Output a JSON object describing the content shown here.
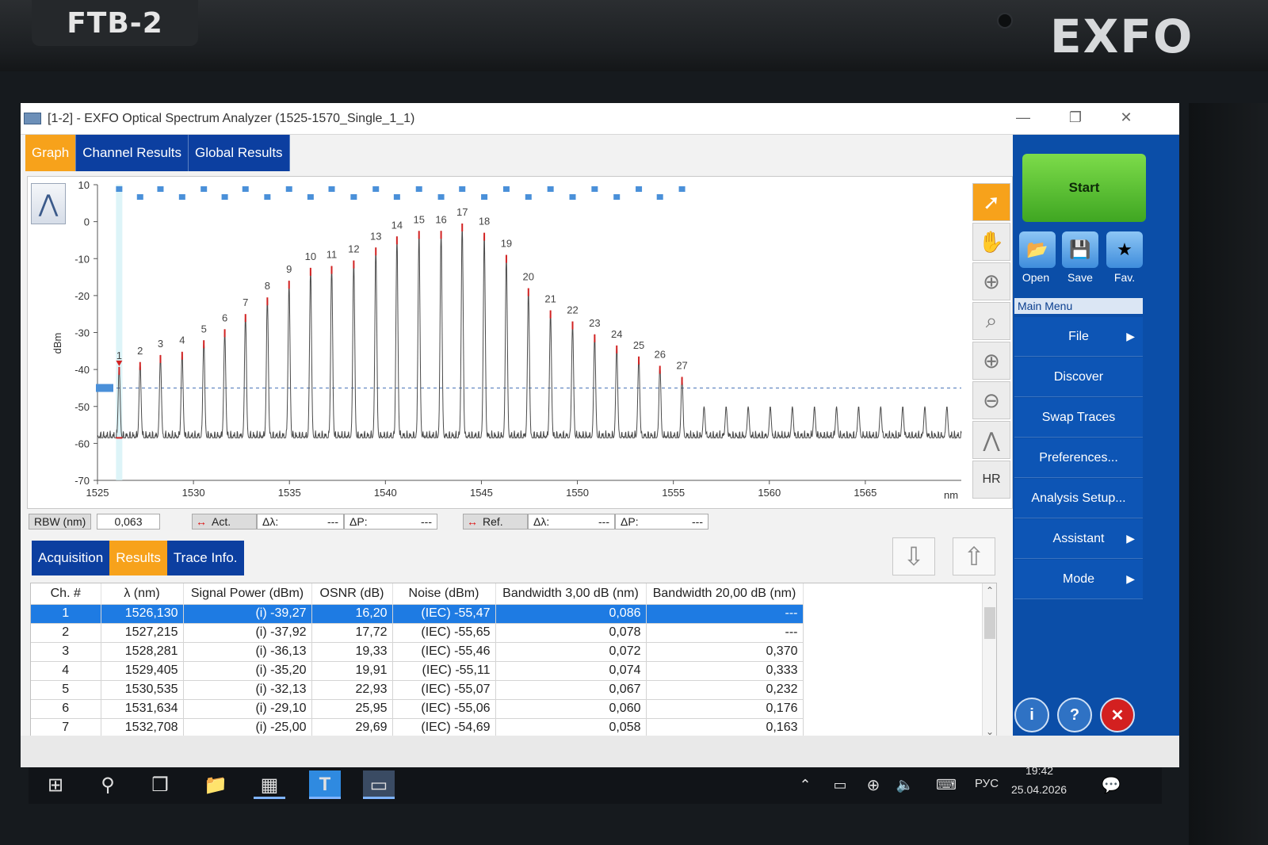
{
  "device": {
    "model": "FTB-2",
    "brand": "EXFO"
  },
  "window": {
    "title": "[1-2] - EXFO Optical Spectrum Analyzer  (1525-1570_Single_1_1)"
  },
  "tabs": [
    {
      "label": "Graph",
      "active": true
    },
    {
      "label": "Channel Results",
      "active": false
    },
    {
      "label": "Global Results",
      "active": false
    }
  ],
  "tools": {
    "hr_label": "HR"
  },
  "cursor_bar": {
    "rbw_label": "RBW (nm)",
    "rbw_value": "0,063",
    "act_label": "Act.",
    "act_dl_label": "Δλ:",
    "act_dl_value": "---",
    "act_dp_label": "ΔP:",
    "act_dp_value": "---",
    "ref_label": "Ref.",
    "ref_dl_label": "Δλ:",
    "ref_dl_value": "---",
    "ref_dp_label": "ΔP:",
    "ref_dp_value": "---"
  },
  "bottom_tabs": [
    {
      "label": "Acquisition",
      "active": false
    },
    {
      "label": "Results",
      "active": true
    },
    {
      "label": "Trace Info.",
      "active": false
    }
  ],
  "results_table": {
    "columns": [
      "Ch. #",
      "λ (nm)",
      "Signal Power (dBm)",
      "OSNR (dB)",
      "Noise (dBm)",
      "Bandwidth 3,00 dB (nm)",
      "Bandwidth 20,00 dB (nm)"
    ],
    "rows": [
      [
        "1",
        "1526,130",
        "(i) -39,27",
        "16,20",
        "(IEC) -55,47",
        "0,086",
        "---"
      ],
      [
        "2",
        "1527,215",
        "(i) -37,92",
        "17,72",
        "(IEC) -55,65",
        "0,078",
        "---"
      ],
      [
        "3",
        "1528,281",
        "(i) -36,13",
        "19,33",
        "(IEC) -55,46",
        "0,072",
        "0,370"
      ],
      [
        "4",
        "1529,405",
        "(i) -35,20",
        "19,91",
        "(IEC) -55,11",
        "0,074",
        "0,333"
      ],
      [
        "5",
        "1530,535",
        "(i) -32,13",
        "22,93",
        "(IEC) -55,07",
        "0,067",
        "0,232"
      ],
      [
        "6",
        "1531,634",
        "(i) -29,10",
        "25,95",
        "(IEC) -55,06",
        "0,060",
        "0,176"
      ],
      [
        "7",
        "1532,708",
        "(i) -25,00",
        "29,69",
        "(IEC) -54,69",
        "0,058",
        "0,163"
      ]
    ],
    "selected_row": 0
  },
  "sidebar": {
    "start_label": "Start",
    "open_label": "Open",
    "save_label": "Save",
    "fav_label": "Fav.",
    "menu_header": "Main Menu",
    "menu_items": [
      {
        "label": "File",
        "submenu": true
      },
      {
        "label": "Discover",
        "submenu": false
      },
      {
        "label": "Swap Traces",
        "submenu": false
      },
      {
        "label": "Preferences...",
        "submenu": false
      },
      {
        "label": "Analysis Setup...",
        "submenu": false
      },
      {
        "label": "Assistant",
        "submenu": true
      },
      {
        "label": "Mode",
        "submenu": true
      }
    ]
  },
  "taskbar": {
    "lang": "РУС",
    "time": "19:42",
    "date": "25.04.2026"
  },
  "chart_data": {
    "type": "line",
    "xlabel": "nm",
    "ylabel": "dBm",
    "xlim": [
      1525,
      1570
    ],
    "ylim": [
      -70,
      10
    ],
    "x_ticks": [
      1525,
      1530,
      1535,
      1540,
      1545,
      1550,
      1555,
      1560,
      1565
    ],
    "y_ticks": [
      10,
      0,
      -10,
      -20,
      -30,
      -40,
      -50,
      -60,
      -70
    ],
    "threshold_dbm": -45,
    "channels": [
      {
        "ch": "1",
        "x": 1526.13,
        "peak": -39.3
      },
      {
        "ch": "2",
        "x": 1527.22,
        "peak": -38.0
      },
      {
        "ch": "3",
        "x": 1528.28,
        "peak": -36.1
      },
      {
        "ch": "4",
        "x": 1529.41,
        "peak": -35.2
      },
      {
        "ch": "5",
        "x": 1530.54,
        "peak": -32.1
      },
      {
        "ch": "6",
        "x": 1531.63,
        "peak": -29.1
      },
      {
        "ch": "7",
        "x": 1532.71,
        "peak": -25.0
      },
      {
        "ch": "8",
        "x": 1533.85,
        "peak": -20.5
      },
      {
        "ch": "9",
        "x": 1534.98,
        "peak": -16.0
      },
      {
        "ch": "10",
        "x": 1536.1,
        "peak": -12.5
      },
      {
        "ch": "11",
        "x": 1537.2,
        "peak": -12.0
      },
      {
        "ch": "12",
        "x": 1538.35,
        "peak": -10.5
      },
      {
        "ch": "13",
        "x": 1539.5,
        "peak": -7.0
      },
      {
        "ch": "14",
        "x": 1540.6,
        "peak": -4.0
      },
      {
        "ch": "15",
        "x": 1541.75,
        "peak": -2.5
      },
      {
        "ch": "16",
        "x": 1542.9,
        "peak": -2.5
      },
      {
        "ch": "17",
        "x": 1544.0,
        "peak": -0.5
      },
      {
        "ch": "18",
        "x": 1545.15,
        "peak": -3.0
      },
      {
        "ch": "19",
        "x": 1546.3,
        "peak": -9.0
      },
      {
        "ch": "20",
        "x": 1547.45,
        "peak": -18.0
      },
      {
        "ch": "21",
        "x": 1548.6,
        "peak": -24.0
      },
      {
        "ch": "22",
        "x": 1549.75,
        "peak": -27.0
      },
      {
        "ch": "23",
        "x": 1550.9,
        "peak": -30.5
      },
      {
        "ch": "24",
        "x": 1552.05,
        "peak": -33.5
      },
      {
        "ch": "25",
        "x": 1553.2,
        "peak": -36.5
      },
      {
        "ch": "26",
        "x": 1554.3,
        "peak": -39.0
      },
      {
        "ch": "27",
        "x": 1555.45,
        "peak": -42.0
      }
    ],
    "unlabeled_peaks_x": [
      1556.6,
      1557.75,
      1558.9,
      1560.05,
      1561.2,
      1562.35,
      1563.5,
      1564.65,
      1565.8,
      1566.95,
      1568.1,
      1569.25
    ],
    "unlabeled_peak_dbm": -50.0,
    "noise_floor_dbm": -58.5,
    "colors": {
      "trace": "#4a4a4a",
      "marker": "#4a90d9",
      "peak_tip": "#d22222",
      "threshold": "#4a74b8",
      "accent": "#f7a21b",
      "tab_blue": "#0c3fa0",
      "selected_row": "#1e7be3"
    }
  }
}
